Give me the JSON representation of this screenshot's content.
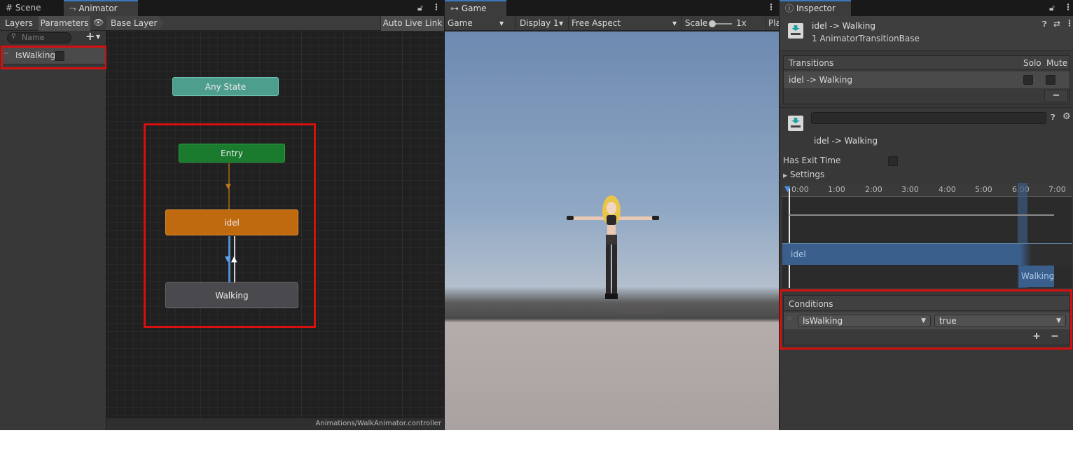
{
  "colors": {
    "accent": "#3a79bb",
    "highlight": "#d60f0f",
    "entry": "#1a7a2e",
    "any_state": "#4e9e8e",
    "idel_state": "#c06a10",
    "walking_state": "#4a4a4e"
  },
  "animator": {
    "tabs": {
      "scene": "Scene",
      "animator": "Animator"
    },
    "left_tabs": {
      "layers": "Layers",
      "parameters": "Parameters"
    },
    "search_placeholder": "Name",
    "add_label": "+",
    "parameter": {
      "name": "IsWalking",
      "value": false
    },
    "breadcrumb": "Base Layer",
    "auto_live_link": "Auto Live Link",
    "states": {
      "any_state": "Any State",
      "entry": "Entry",
      "idel": "idel",
      "walking": "Walking"
    },
    "footer_path": "Animations/WalkAnimator.controller"
  },
  "game": {
    "tab": "Game",
    "toolbar": {
      "mode": "Game",
      "display": "Display 1",
      "aspect": "Free Aspect",
      "scale_label": "Scale",
      "scale_value": "1x",
      "play_label": "Pla"
    }
  },
  "inspector": {
    "tab": "Inspector",
    "header": {
      "title": "idel -> Walking",
      "subtitle": "1 AnimatorTransitionBase"
    },
    "transitions_header": {
      "label": "Transitions",
      "solo": "Solo",
      "mute": "Mute"
    },
    "transition_row": "idel -> Walking",
    "minus_label": "−",
    "detail_name": "idel -> Walking",
    "has_exit_time_label": "Has Exit Time",
    "settings_label": "Settings",
    "timeline_ticks": [
      "0:00",
      "1:00",
      "2:00",
      "3:00",
      "4:00",
      "5:00",
      "6:00",
      "7:00"
    ],
    "timeline_source": "idel",
    "timeline_dest": "Walking",
    "conditions": {
      "label": "Conditions",
      "parameter": "IsWalking",
      "value": "true",
      "add_label": "+",
      "remove_label": "−"
    }
  },
  "icons": [
    "hash-icon",
    "animator-icon",
    "lock-icon",
    "kebab-icon",
    "eye-icon",
    "gamepad-icon",
    "info-icon",
    "help-icon",
    "preset-icon",
    "settings-icon",
    "transition-icon"
  ]
}
